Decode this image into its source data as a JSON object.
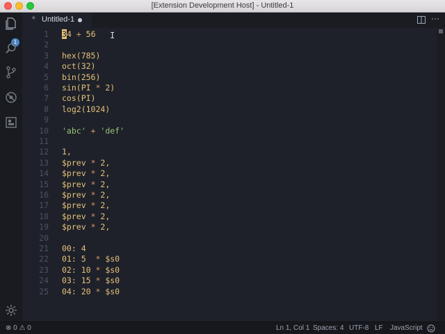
{
  "window": {
    "title": "[Extension Development Host] - Untitled-1"
  },
  "activity_bar": {
    "items": [
      "explorer-icon",
      "search-icon",
      "source-control-icon",
      "debug-icon",
      "extensions-icon"
    ],
    "explorer_badge": "1",
    "bottom": [
      "settings-gear-icon"
    ]
  },
  "tab": {
    "icon": "*",
    "label": "Untitled-1",
    "dirty": true
  },
  "editor": {
    "lines": [
      {
        "n": "1",
        "tokens": [
          [
            "cursor",
            "3"
          ],
          [
            "num",
            "4"
          ],
          [
            "op",
            " + "
          ],
          [
            "num",
            "56"
          ]
        ]
      },
      {
        "n": "2",
        "tokens": []
      },
      {
        "n": "3",
        "tokens": [
          [
            "fn",
            "hex(785)"
          ]
        ]
      },
      {
        "n": "4",
        "tokens": [
          [
            "fn",
            "oct(32)"
          ]
        ]
      },
      {
        "n": "5",
        "tokens": [
          [
            "fn",
            "bin(256)"
          ]
        ]
      },
      {
        "n": "6",
        "tokens": [
          [
            "fn",
            "sin(PI "
          ],
          [
            "op",
            "*"
          ],
          [
            "fn",
            " 2)"
          ]
        ]
      },
      {
        "n": "7",
        "tokens": [
          [
            "fn",
            "cos(PI)"
          ]
        ]
      },
      {
        "n": "8",
        "tokens": [
          [
            "fn",
            "log2(1024)"
          ]
        ]
      },
      {
        "n": "9",
        "tokens": []
      },
      {
        "n": "10",
        "tokens": [
          [
            "str",
            "'abc'"
          ],
          [
            "op",
            " + "
          ],
          [
            "str",
            "'def'"
          ]
        ]
      },
      {
        "n": "11",
        "tokens": []
      },
      {
        "n": "12",
        "tokens": [
          [
            "num",
            "1,"
          ]
        ]
      },
      {
        "n": "13",
        "tokens": [
          [
            "var",
            "$prev "
          ],
          [
            "op",
            "*"
          ],
          [
            "num",
            " 2,"
          ]
        ]
      },
      {
        "n": "14",
        "tokens": [
          [
            "var",
            "$prev "
          ],
          [
            "op",
            "*"
          ],
          [
            "num",
            " 2,"
          ]
        ]
      },
      {
        "n": "15",
        "tokens": [
          [
            "var",
            "$prev "
          ],
          [
            "op",
            "*"
          ],
          [
            "num",
            " 2,"
          ]
        ]
      },
      {
        "n": "16",
        "tokens": [
          [
            "var",
            "$prev "
          ],
          [
            "op",
            "*"
          ],
          [
            "num",
            " 2,"
          ]
        ]
      },
      {
        "n": "17",
        "tokens": [
          [
            "var",
            "$prev "
          ],
          [
            "op",
            "*"
          ],
          [
            "num",
            " 2,"
          ]
        ]
      },
      {
        "n": "18",
        "tokens": [
          [
            "var",
            "$prev "
          ],
          [
            "op",
            "*"
          ],
          [
            "num",
            " 2,"
          ]
        ]
      },
      {
        "n": "19",
        "tokens": [
          [
            "var",
            "$prev "
          ],
          [
            "op",
            "*"
          ],
          [
            "num",
            " 2,"
          ]
        ]
      },
      {
        "n": "20",
        "tokens": []
      },
      {
        "n": "21",
        "tokens": [
          [
            "num",
            "00: 4"
          ]
        ]
      },
      {
        "n": "22",
        "tokens": [
          [
            "num",
            "01: 5  "
          ],
          [
            "op",
            "*"
          ],
          [
            "var",
            " $s0"
          ]
        ]
      },
      {
        "n": "23",
        "tokens": [
          [
            "num",
            "02: 10 "
          ],
          [
            "op",
            "*"
          ],
          [
            "var",
            " $s0"
          ]
        ]
      },
      {
        "n": "24",
        "tokens": [
          [
            "num",
            "03: 15 "
          ],
          [
            "op",
            "*"
          ],
          [
            "var",
            " $s0"
          ]
        ]
      },
      {
        "n": "25",
        "tokens": [
          [
            "num",
            "04: 20 "
          ],
          [
            "op",
            "*"
          ],
          [
            "var",
            " $s0"
          ]
        ]
      }
    ]
  },
  "status_bar": {
    "errors": "0",
    "warnings": "0",
    "position": "Ln 1, Col 1",
    "spaces": "Spaces: 4",
    "encoding": "UTF-8",
    "eol": "LF",
    "language": "JavaScript"
  },
  "colors": {
    "background": "#1e2129",
    "line_number": "#4b5263",
    "number": "#e6c07b",
    "operator": "#d19a66",
    "string": "#98c379",
    "badge": "#4a84c1"
  }
}
